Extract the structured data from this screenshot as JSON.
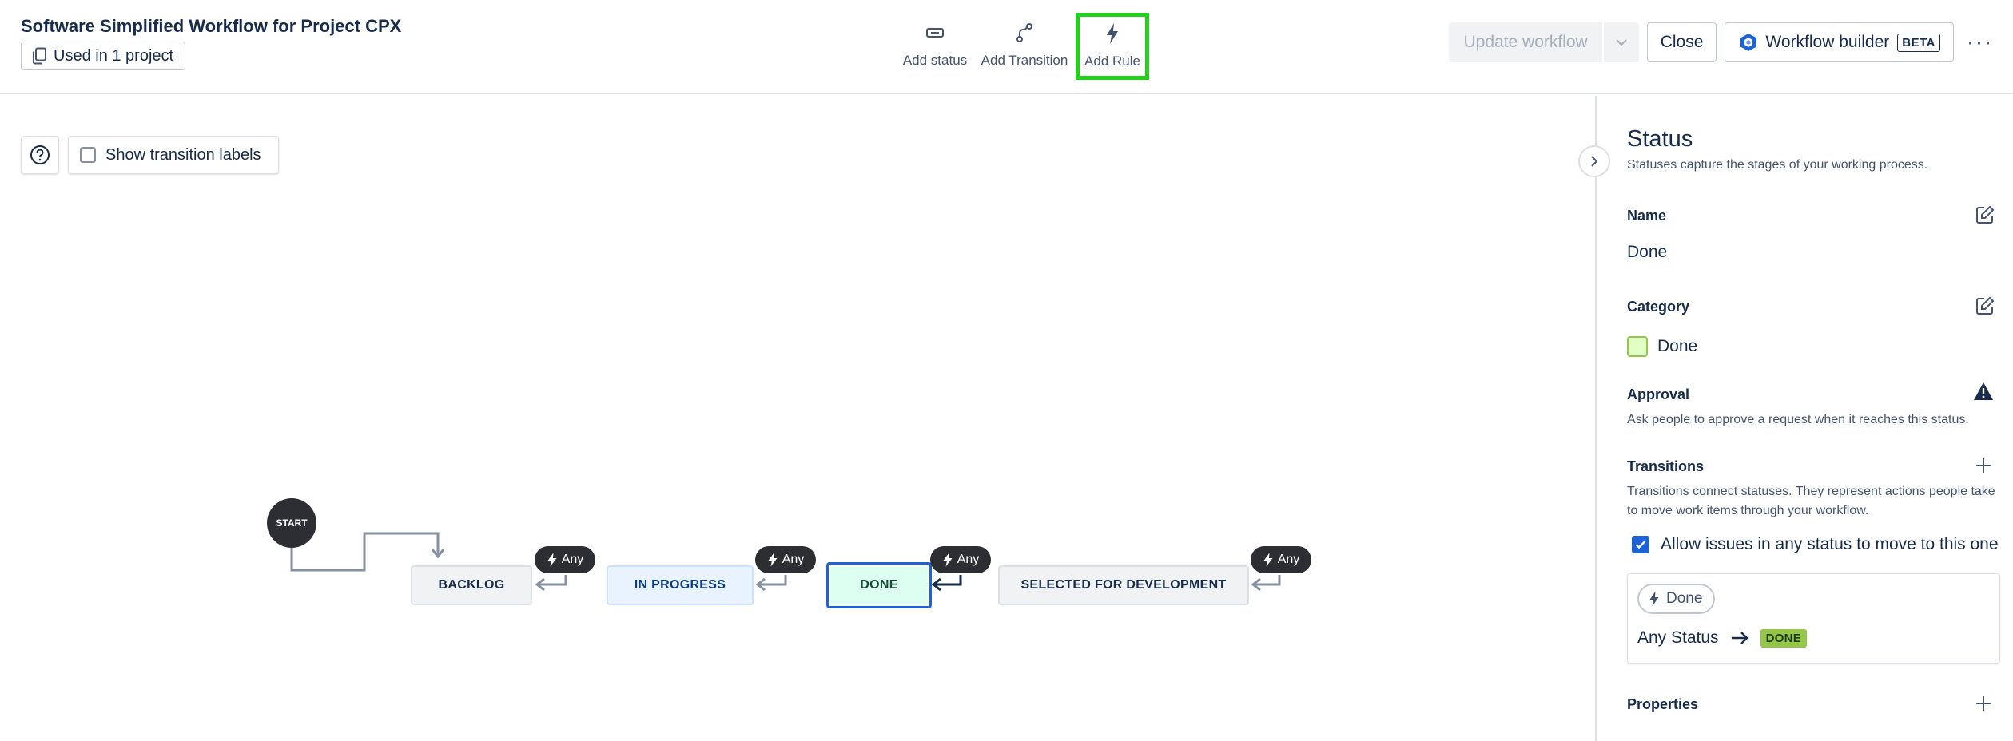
{
  "header": {
    "title": "Software Simplified Workflow for Project CPX",
    "used_in": "Used in 1 project",
    "tools": {
      "add_status": "Add status",
      "add_transition": "Add Transition",
      "add_rule": "Add Rule"
    },
    "update_workflow": "Update workflow",
    "close": "Close",
    "workflow_builder": "Workflow builder",
    "beta": "BETA",
    "more": "···"
  },
  "canvas": {
    "show_transition_labels": "Show transition labels",
    "start": "START",
    "statuses": {
      "backlog": "BACKLOG",
      "in_progress": "IN PROGRESS",
      "done": "DONE",
      "selected": "SELECTED FOR DEVELOPMENT"
    },
    "any_label": "Any"
  },
  "panel": {
    "title": "Status",
    "subtitle": "Statuses capture the stages of your working process.",
    "name_label": "Name",
    "name_value": "Done",
    "category_label": "Category",
    "category_value": "Done",
    "approval_label": "Approval",
    "approval_desc": "Ask people to approve a request when it reaches this status.",
    "transitions_label": "Transitions",
    "transitions_desc": "Transitions connect statuses. They represent actions people take to move work items through your workflow.",
    "allow_any": "Allow issues in any status to move to this one",
    "rule_chip": "Done",
    "any_status": "Any Status",
    "target_lozenge": "DONE",
    "properties_label": "Properties"
  },
  "colors": {
    "highlight": "#22d11a",
    "selected_border": "#1d63d6",
    "done_lozenge": "#94c748",
    "pill_dark": "#2c2e33"
  }
}
